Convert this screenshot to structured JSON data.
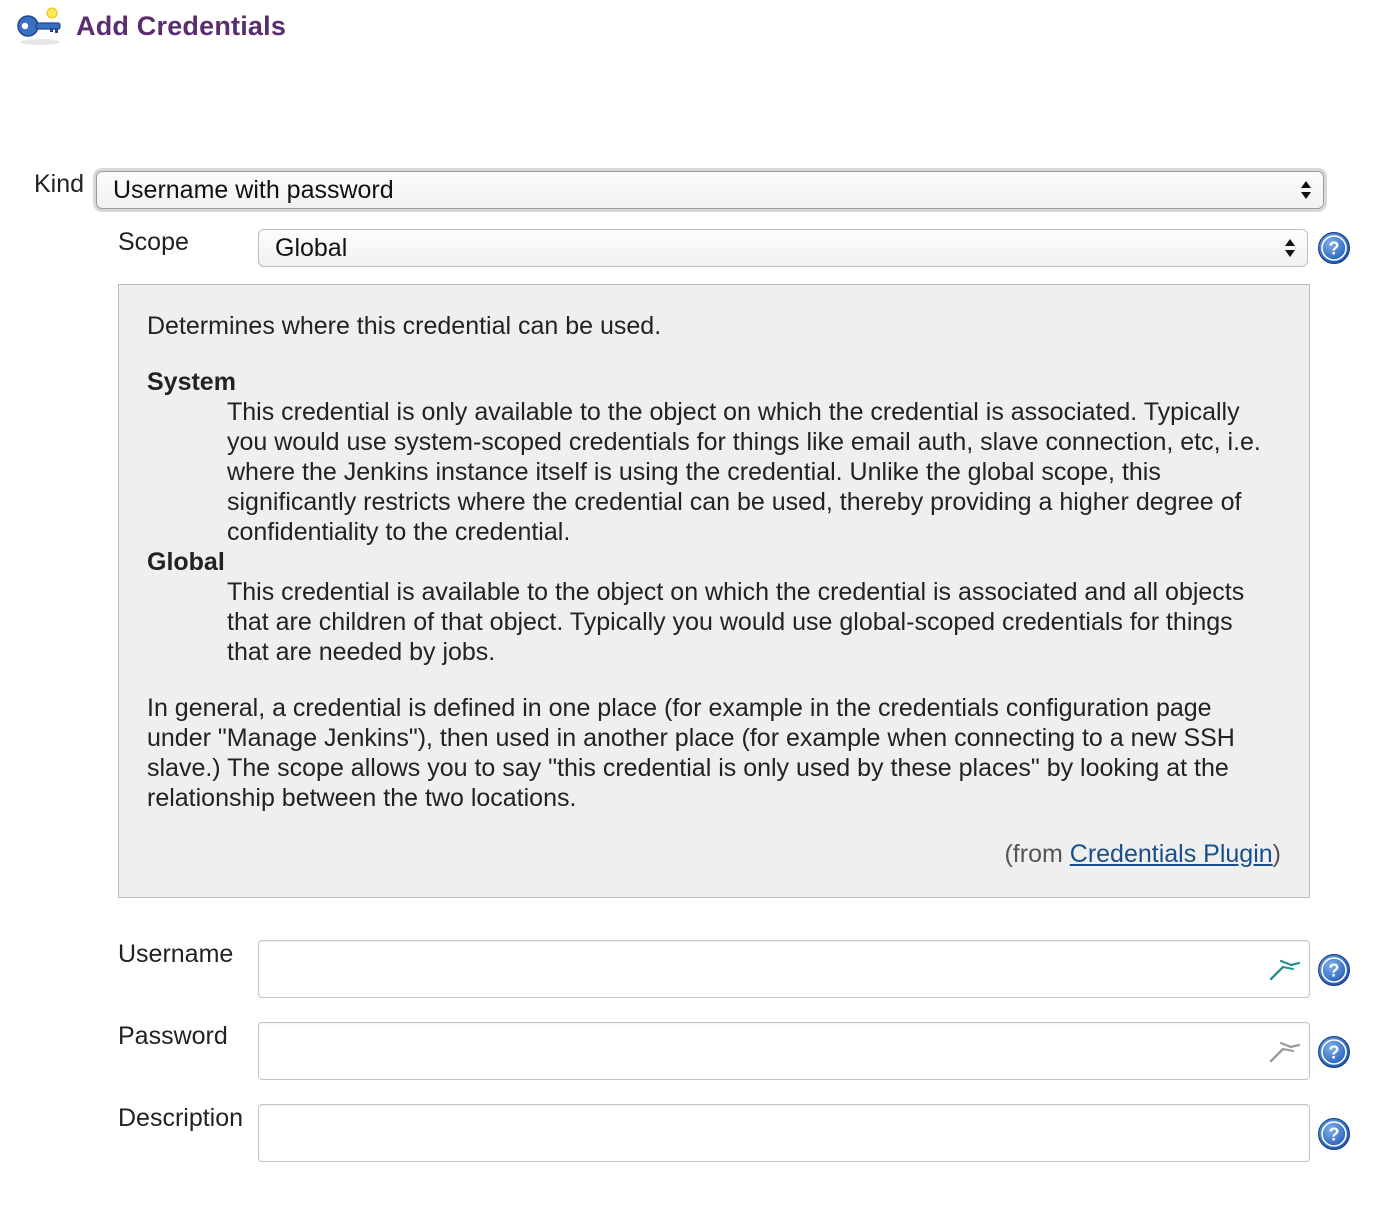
{
  "header": {
    "title": "Add Credentials",
    "icon": "credentials-key-icon"
  },
  "form": {
    "kind": {
      "label": "Kind",
      "selected": "Username with password"
    },
    "scope": {
      "label": "Scope",
      "selected": "Global"
    },
    "username": {
      "label": "Username",
      "value": ""
    },
    "password": {
      "label": "Password",
      "value": ""
    },
    "description": {
      "label": "Description",
      "value": ""
    }
  },
  "help": {
    "intro": "Determines where this credential can be used.",
    "system_term": "System",
    "system_desc": "This credential is only available to the object on which the credential is associated. Typically you would use system-scoped credentials for things like email auth, slave connection, etc, i.e. where the Jenkins instance itself is using the credential. Unlike the global scope, this significantly restricts where the credential can be used, thereby providing a higher degree of confidentiality to the credential.",
    "global_term": "Global",
    "global_desc": "This credential is available to the object on which the credential is associated and all objects that are children of that object. Typically you would use global-scoped credentials for things that are needed by jobs.",
    "general": "In general, a credential is defined in one place (for example in the credentials configuration page under \"Manage Jenkins\"), then used in another place (for example when connecting to a new SSH slave.) The scope allows you to say \"this credential is only used by these places\" by looking at the relationship between the two locations.",
    "from_prefix": "(from ",
    "from_link": "Credentials Plugin",
    "from_suffix": ")"
  },
  "colors": {
    "title": "#5a2d6e",
    "help_icon": "#2a66b8",
    "link": "#1a4f8a",
    "help_bg": "#efefef"
  }
}
